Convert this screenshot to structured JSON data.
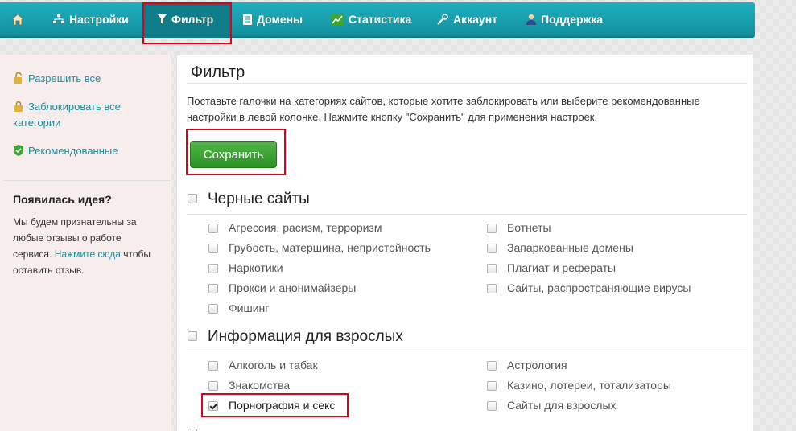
{
  "nav": {
    "items": [
      {
        "label": "",
        "icon": "home-icon"
      },
      {
        "label": "Настройки",
        "icon": "sitemap-icon"
      },
      {
        "label": "Фильтр",
        "icon": "filter-icon",
        "active": true
      },
      {
        "label": "Домены",
        "icon": "book-icon"
      },
      {
        "label": "Статистика",
        "icon": "chart-icon"
      },
      {
        "label": "Аккаунт",
        "icon": "wrench-icon"
      },
      {
        "label": "Поддержка",
        "icon": "user-icon"
      }
    ],
    "colors": {
      "bar": "#1aa3b2",
      "highlight": "#e0001a"
    }
  },
  "sidebar": {
    "links": [
      {
        "label": "Разрешить все",
        "icon": "unlock-icon"
      },
      {
        "label": "Заблокировать все категории",
        "icon": "lock-icon"
      },
      {
        "label": "Рекомендованные",
        "icon": "shield-check-icon"
      }
    ],
    "idea": {
      "title": "Появилась идея?",
      "text_before": "Мы будем признательны за любые отзывы о работе сервиса.",
      "link": "Нажмите сюда",
      "text_after": "чтобы оставить отзыв."
    }
  },
  "main": {
    "title": "Фильтр",
    "description": "Поставьте галочки на категориях сайтов, которые хотите заблокировать или выберите рекомендованные настройки в левой колонке. Нажмите кнопку \"Сохранить\" для применения настроек.",
    "save_label": "Сохранить",
    "sections": [
      {
        "title": "Черные сайты",
        "checked": false,
        "left": [
          {
            "label": "Агрессия, расизм, терроризм",
            "checked": false
          },
          {
            "label": "Грубость, матершина, непристойность",
            "checked": false
          },
          {
            "label": "Наркотики",
            "checked": false
          },
          {
            "label": "Прокси и анонимайзеры",
            "checked": false
          },
          {
            "label": "Фишинг",
            "checked": false
          }
        ],
        "right": [
          {
            "label": "Ботнеты",
            "checked": false
          },
          {
            "label": "Запаркованные домены",
            "checked": false
          },
          {
            "label": "Плагиат и рефераты",
            "checked": false
          },
          {
            "label": "Сайты, распространяющие вирусы",
            "checked": false
          }
        ]
      },
      {
        "title": "Информация для взрослых",
        "checked": false,
        "left": [
          {
            "label": "Алкоголь и табак",
            "checked": false
          },
          {
            "label": "Знакомства",
            "checked": false
          },
          {
            "label": "Порнография и секс",
            "checked": true
          }
        ],
        "right": [
          {
            "label": "Астрология",
            "checked": false
          },
          {
            "label": "Казино, лотереи, тотализаторы",
            "checked": false
          },
          {
            "label": "Сайты для взрослых",
            "checked": false
          }
        ]
      }
    ],
    "colors": {
      "button": "#3aa232",
      "link": "#1c8f9d"
    }
  }
}
